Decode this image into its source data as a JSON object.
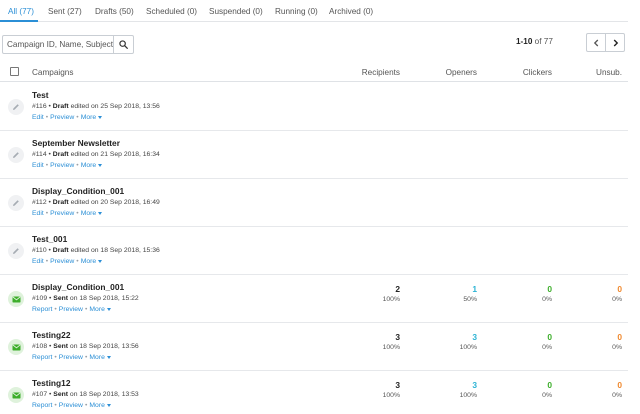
{
  "tabs": [
    {
      "label": "All (77)",
      "active": true
    },
    {
      "label": "Sent (27)"
    },
    {
      "label": "Drafts (50)"
    },
    {
      "label": "Scheduled (0)"
    },
    {
      "label": "Suspended (0)"
    },
    {
      "label": "Running (0)"
    },
    {
      "label": "Archived (0)"
    }
  ],
  "search": {
    "placeholder": "Campaign ID, Name, Subject",
    "icon": "search-icon"
  },
  "pagination": {
    "range": "1-10",
    "of_label": "of",
    "total": "77"
  },
  "table": {
    "columns": {
      "campaigns": "Campaigns",
      "recipients": "Recipients",
      "openers": "Openers",
      "clickers": "Clickers",
      "unsub": "Unsub."
    }
  },
  "rows": [
    {
      "name": "Test",
      "id": "#116",
      "status": "Draft",
      "action_text": "edited on 25 Sep 2018, 13:56",
      "links": [
        "Edit",
        "Preview",
        "More"
      ]
    },
    {
      "name": "September Newsletter",
      "id": "#114",
      "status": "Draft",
      "action_text": "edited on 21 Sep 2018, 16:34",
      "links": [
        "Edit",
        "Preview",
        "More"
      ]
    },
    {
      "name": "Display_Condition_001",
      "id": "#112",
      "status": "Draft",
      "action_text": "edited on 20 Sep 2018, 16:49",
      "links": [
        "Edit",
        "Preview",
        "More"
      ]
    },
    {
      "name": "Test_001",
      "id": "#110",
      "status": "Draft",
      "action_text": "edited on 18 Sep 2018, 15:36",
      "links": [
        "Edit",
        "Preview",
        "More"
      ]
    },
    {
      "name": "Display_Condition_001",
      "id": "#109",
      "status": "Sent",
      "action_text": "on 18 Sep 2018, 15:22",
      "links": [
        "Report",
        "Preview",
        "More"
      ],
      "recipients": "2",
      "recipients_pct": "100%",
      "openers": "1",
      "openers_pct": "50%",
      "clickers": "0",
      "clickers_pct": "0%",
      "unsub": "0",
      "unsub_pct": "0%"
    },
    {
      "name": "Testing22",
      "id": "#108",
      "status": "Sent",
      "action_text": "on 18 Sep 2018, 13:56",
      "links": [
        "Report",
        "Preview",
        "More"
      ],
      "recipients": "3",
      "recipients_pct": "100%",
      "openers": "3",
      "openers_pct": "100%",
      "clickers": "0",
      "clickers_pct": "0%",
      "unsub": "0",
      "unsub_pct": "0%"
    },
    {
      "name": "Testing12",
      "id": "#107",
      "status": "Sent",
      "action_text": "on 18 Sep 2018, 13:53",
      "links": [
        "Report",
        "Preview",
        "More"
      ],
      "recipients": "3",
      "recipients_pct": "100%",
      "openers": "3",
      "openers_pct": "100%",
      "clickers": "0",
      "clickers_pct": "0%",
      "unsub": "0",
      "unsub_pct": "0%"
    }
  ],
  "colors": {
    "accent": "#2b8fd6",
    "recipients": "#222222",
    "openers": "#2bb3d4",
    "clickers": "#3dae2b",
    "unsub": "#f0892e",
    "sent_icon": "#3dae2b",
    "draft_icon": "#a6acb3"
  },
  "icons": {
    "draft": "pencil-icon",
    "sent": "envelope-icon",
    "prev": "chevron-left-icon",
    "next": "chevron-right-icon"
  }
}
